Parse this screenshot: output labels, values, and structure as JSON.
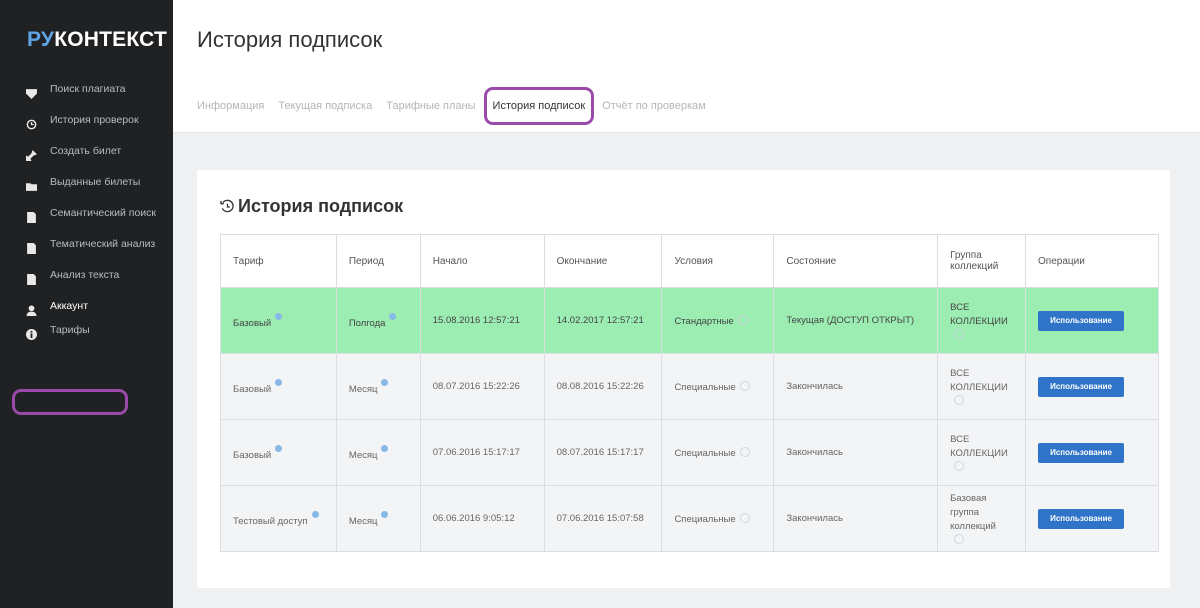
{
  "logo": {
    "part1": "РУ",
    "part2": "КОНТЕКСТ"
  },
  "sidebar": {
    "items": [
      {
        "label": "Поиск плагиата",
        "icon": "shield-icon"
      },
      {
        "label": "История проверок",
        "icon": "history-icon"
      },
      {
        "label": "Создать билет",
        "icon": "pin-icon"
      },
      {
        "label": "Выданные билеты",
        "icon": "folder-icon"
      },
      {
        "label": "Семантический поиск",
        "icon": "document-icon"
      },
      {
        "label": "Тематический анализ",
        "icon": "document-icon"
      },
      {
        "label": "Анализ текста",
        "icon": "document-icon"
      },
      {
        "label": "Аккаунт",
        "icon": "user-icon"
      },
      {
        "label": "Тарифы",
        "icon": "info-icon"
      }
    ]
  },
  "header": {
    "title": "История подписок"
  },
  "tabs": [
    {
      "label": "Информация"
    },
    {
      "label": "Текущая подписка"
    },
    {
      "label": "Тарифные планы"
    },
    {
      "label": "История подписок"
    },
    {
      "label": "Отчёт по проверкам"
    }
  ],
  "card": {
    "title": "История подписок"
  },
  "table": {
    "columns": [
      "Тариф",
      "Период",
      "Начало",
      "Окончание",
      "Условия",
      "Состояние",
      "Группа коллекций",
      "Операции"
    ],
    "rows": [
      {
        "tariff": "Базовый",
        "period": "Полгода",
        "start": "15.08.2016 12:57:21",
        "end": "14.02.2017 12:57:21",
        "terms": "Стандартные",
        "state": "Текущая (ДОСТУП ОТКРЫТ)",
        "group": "ВСЕ КОЛЛЕКЦИИ",
        "action": "Использование"
      },
      {
        "tariff": "Базовый",
        "period": "Месяц",
        "start": "08.07.2016 15:22:26",
        "end": "08.08.2016 15:22:26",
        "terms": "Специальные",
        "state": "Закончилась",
        "group": "ВСЕ КОЛЛЕКЦИИ",
        "action": "Использование"
      },
      {
        "tariff": "Базовый",
        "period": "Месяц",
        "start": "07.06.2016 15:17:17",
        "end": "08.07.2016 15:17:17",
        "terms": "Специальные",
        "state": "Закончилась",
        "group": "ВСЕ КОЛЛЕКЦИИ",
        "action": "Использование"
      },
      {
        "tariff": "Тестовый доступ",
        "period": "Месяц",
        "start": "06.06.2016 9:05:12",
        "end": "07.06.2016 15:07:58",
        "terms": "Специальные",
        "state": "Закончилась",
        "group": "Базовая группа коллекций",
        "action": "Использование"
      }
    ]
  },
  "colors": {
    "sidebar_bg": "#1f2123",
    "logo_accent": "#5fa5e6",
    "highlight": "#9a4aa8",
    "current_row": "#9cedb2",
    "button": "#2f74c8"
  }
}
